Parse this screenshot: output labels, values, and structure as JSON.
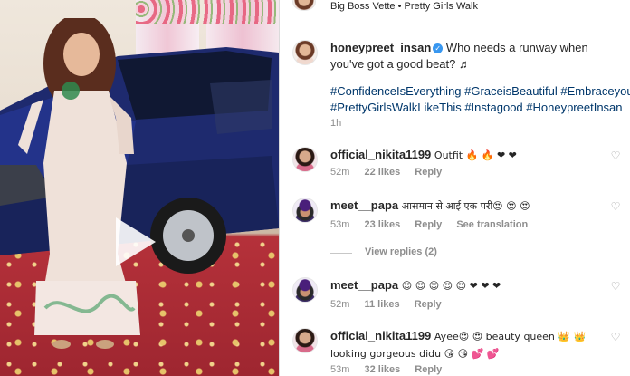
{
  "post": {
    "audio_label": "Big Boss Vette • Pretty Girls Walk",
    "caption_user": "honeypreet_insan",
    "caption_text": "Who needs a runway when you've got a good beat? ♬",
    "caption_tags_1": "#ConfidenceIsEverything #GraceisBeautiful #EmbraceyourBeau",
    "caption_tags_2": "#PrettyGirlsWalkLikeThis #Instagood #HoneypreetInsan",
    "caption_time": "1h"
  },
  "comments": [
    {
      "user": "official_nikita1199",
      "text": "Outfit 🔥 🔥 ❤ ❤",
      "time": "52m",
      "likes": "22 likes",
      "reply": "Reply"
    },
    {
      "user": "meet__papa",
      "text": "आसमान से आई एक परी😍 😍 😍",
      "time": "53m",
      "likes": "23 likes",
      "reply": "Reply",
      "translation": "See translation"
    },
    {
      "user": "meet__papa",
      "text": "😍 😍 😍 😍 😍 ❤ ❤ ❤",
      "time": "52m",
      "likes": "11 likes",
      "reply": "Reply"
    },
    {
      "user": "official_nikita1199",
      "text": "Ayee😍 😍  beauty queen 👑 👑  looking gorgeous didu 😘 😘 💕 💕",
      "time": "53m",
      "likes": "32 likes",
      "reply": "Reply"
    }
  ],
  "view_replies": "View replies (2)",
  "icons": {
    "heart": "heart-outline-icon",
    "play": "play-icon",
    "verified": "verified-badge-icon"
  },
  "colors": {
    "link": "#00376b",
    "muted": "#8e8e8e",
    "verified": "#3897f0"
  }
}
